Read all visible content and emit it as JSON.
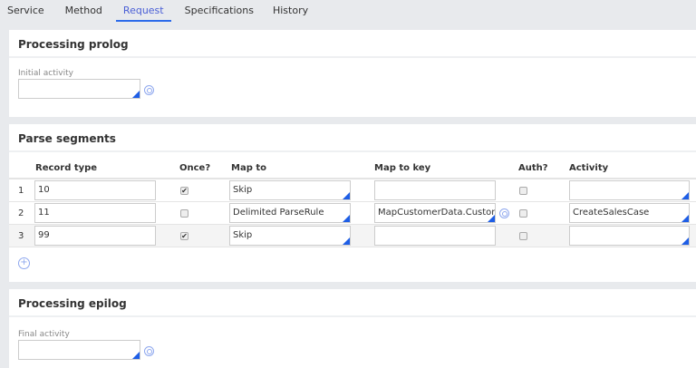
{
  "tabs": [
    "Service",
    "Method",
    "Request",
    "Specifications",
    "History"
  ],
  "active_tab": "Request",
  "prolog": {
    "title": "Processing prolog",
    "label": "Initial activity",
    "value": ""
  },
  "parse": {
    "title": "Parse segments",
    "columns": [
      "Record type",
      "Once?",
      "Map to",
      "Map to key",
      "Auth?",
      "Activity"
    ],
    "rows": [
      {
        "n": "1",
        "record": "10",
        "once": true,
        "map_to": "Skip",
        "key": "",
        "auth": false,
        "activity": ""
      },
      {
        "n": "2",
        "record": "11",
        "once": false,
        "map_to": "Delimited ParseRule",
        "key": "MapCustomerData.Custon",
        "auth": false,
        "activity": "CreateSalesCase"
      },
      {
        "n": "3",
        "record": "99",
        "once": true,
        "map_to": "Skip",
        "key": "",
        "auth": false,
        "activity": ""
      }
    ]
  },
  "epilog": {
    "title": "Processing epilog",
    "label": "Final activity",
    "value": ""
  }
}
